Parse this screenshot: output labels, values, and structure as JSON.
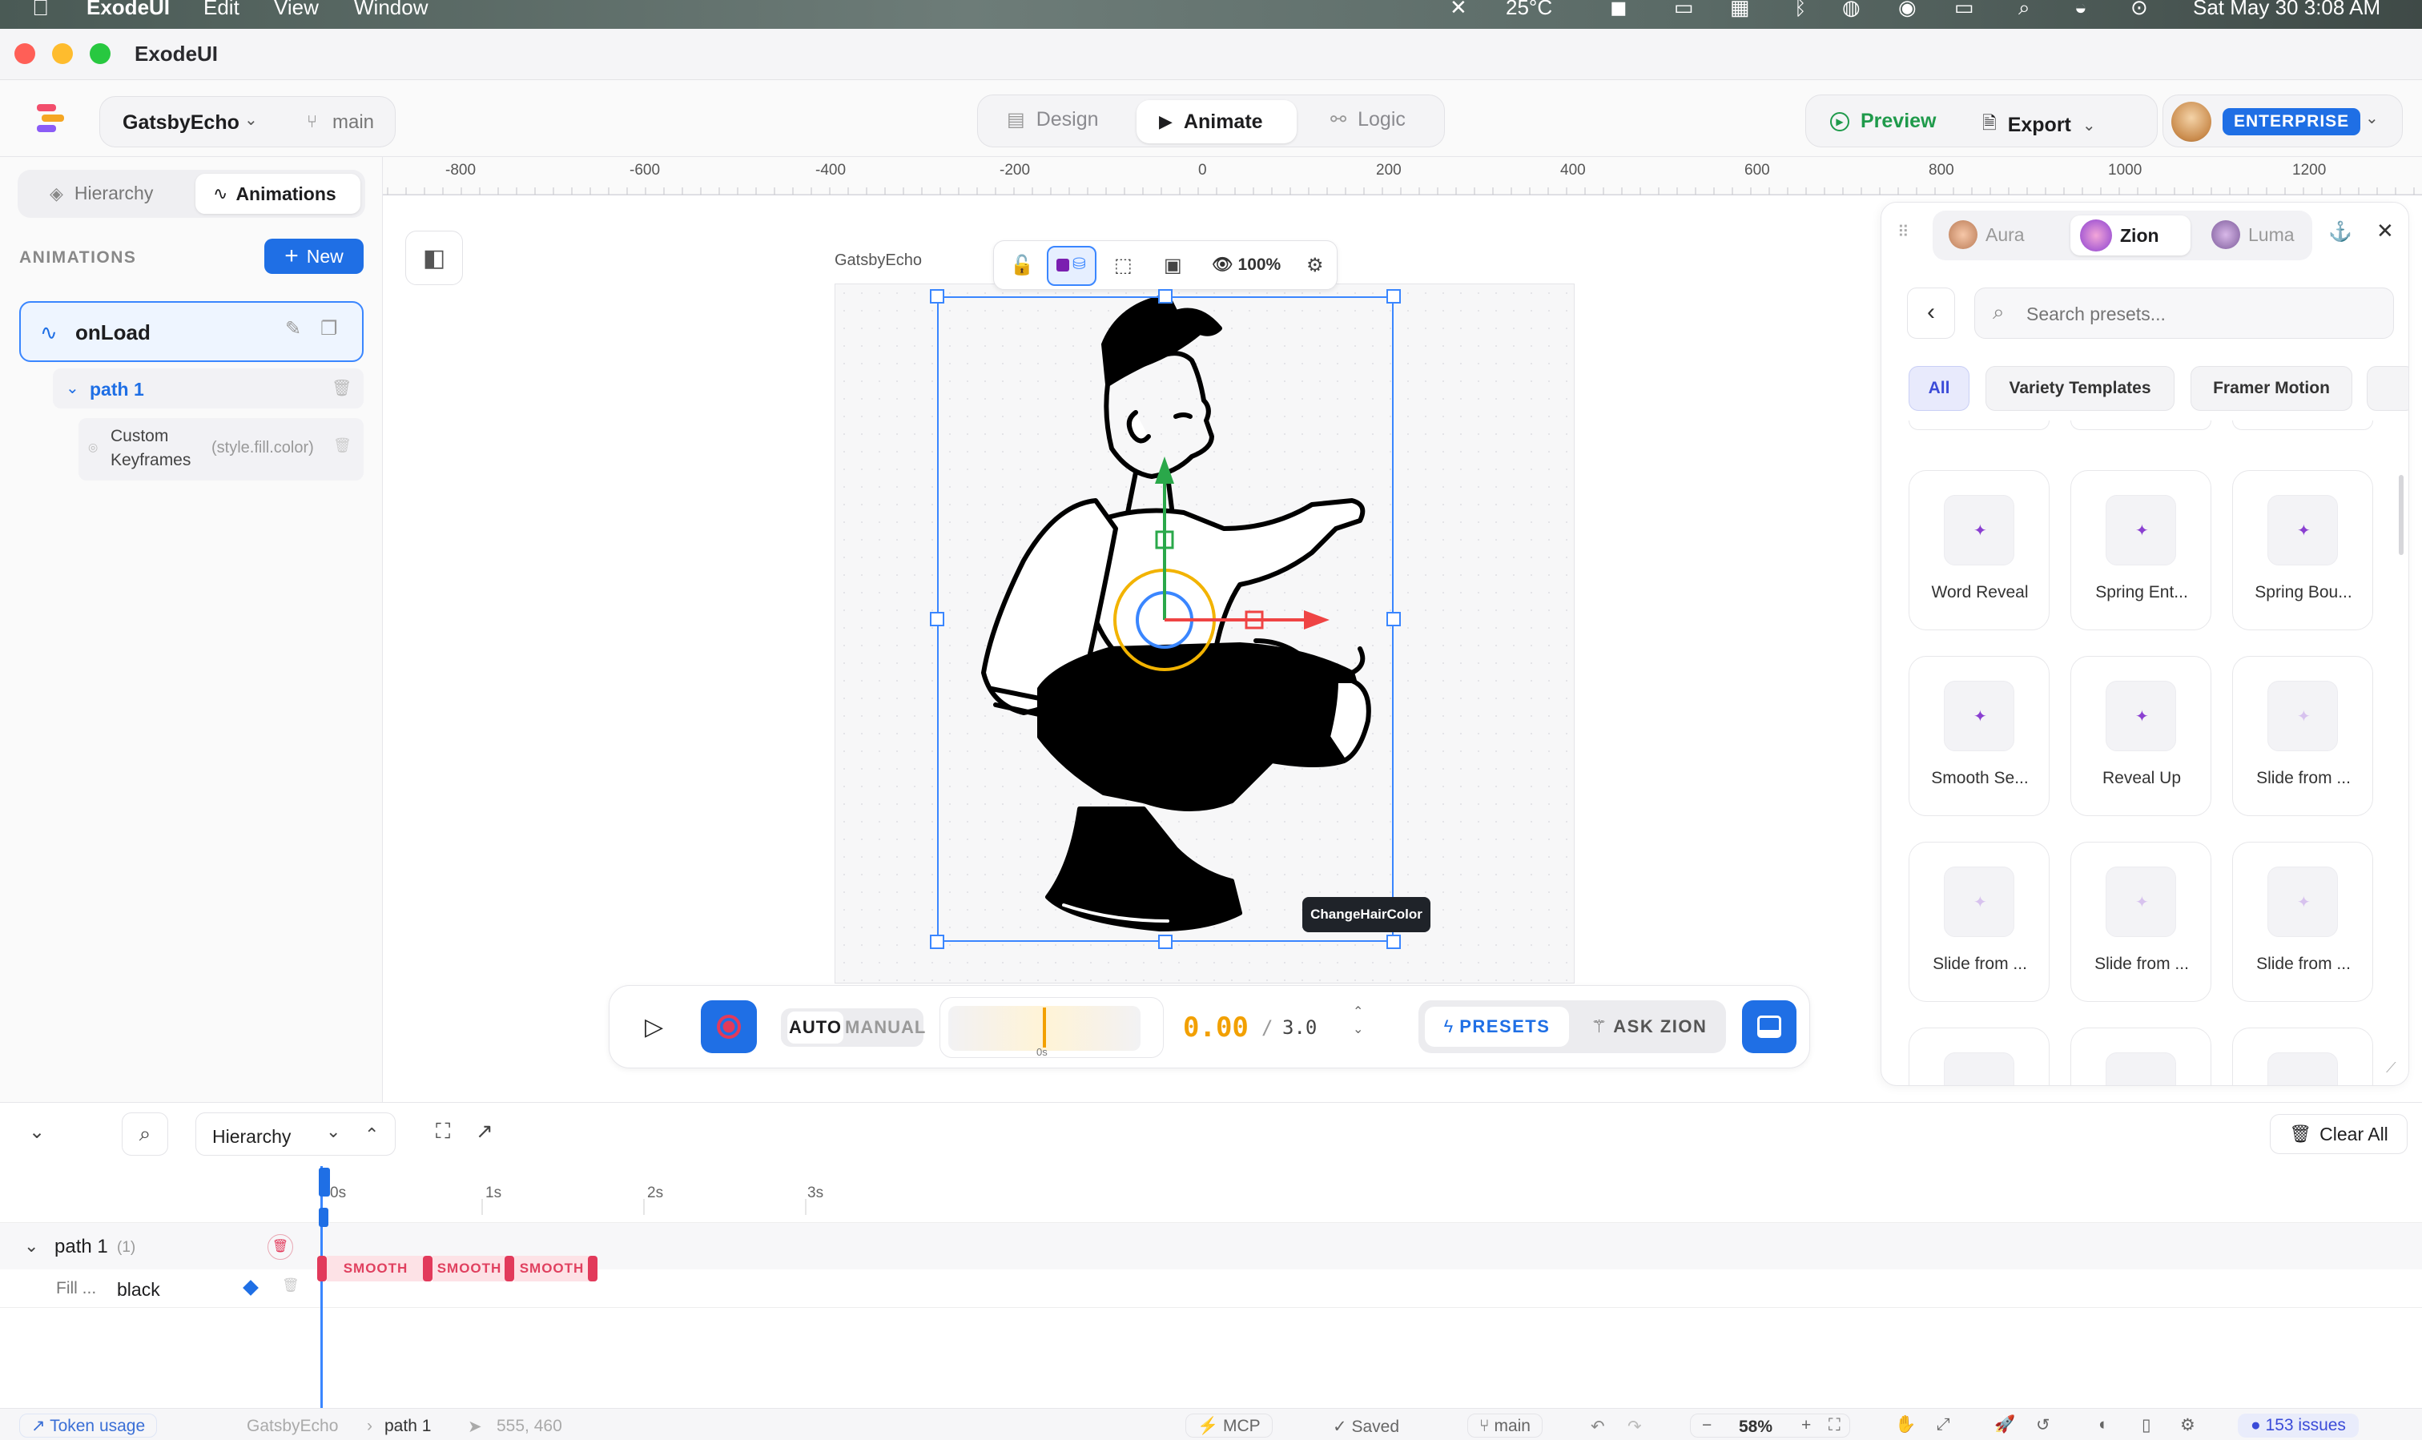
{
  "menubar": {
    "app": "ExodeUI",
    "items": [
      "Edit",
      "View",
      "Window"
    ],
    "temperature": "25°C",
    "clock": "Sat May 30  3:08 AM"
  },
  "window": {
    "title": "ExodeUI"
  },
  "toolbar": {
    "project": "GatsbyEcho",
    "branch": "main",
    "modes": [
      "Design",
      "Animate",
      "Logic"
    ],
    "active_mode": "Animate",
    "preview_label": "Preview",
    "export_label": "Export",
    "plan_badge": "ENTERPRISE"
  },
  "sidebar": {
    "tabs": [
      "Hierarchy",
      "Animations"
    ],
    "active_tab": "Animations",
    "section_title": "ANIMATIONS",
    "new_label": "New",
    "animation_name": "onLoad",
    "path_label": "path 1",
    "keyframe_label": "Custom Keyframes",
    "keyframe_prop": "(style.fill.color)"
  },
  "ruler": {
    "ticks": [
      "-800",
      "-600",
      "-400",
      "-200",
      "0",
      "200",
      "400",
      "600",
      "800",
      "1000",
      "1200"
    ]
  },
  "canvas": {
    "frame_label": "GatsbyEcho",
    "zoom_visibility": "100%",
    "tooltip": "ChangeHairColor"
  },
  "playback": {
    "auto_label": "AUTO",
    "manual_label": "MANUAL",
    "scrub_label": "0s",
    "current_time": "0.00",
    "separator": "/",
    "duration": "3.0",
    "presets_label": "PRESETS",
    "ask_label": "ASK ZION"
  },
  "presets_panel": {
    "tabs": [
      "Aura",
      "Zion",
      "Luma"
    ],
    "active_tab": "Zion",
    "search_placeholder": "Search presets...",
    "chips": [
      "All",
      "Variety Templates",
      "Framer Motion"
    ],
    "active_chip": "All",
    "cards": [
      "Word Reveal",
      "Spring Ent...",
      "Spring Bou...",
      "Smooth Se...",
      "Reveal Up",
      "Slide from ...",
      "Slide from ...",
      "Slide from ...",
      "Slide from ..."
    ]
  },
  "timeline": {
    "view_select": "Hierarchy",
    "clear_label": "Clear All",
    "time_marks": [
      "0s",
      "1s",
      "2s",
      "3s"
    ],
    "track_name": "path 1",
    "track_count": "(1)",
    "property_label": "Fill ...",
    "property_value": "black",
    "segments": [
      "SMOOTH",
      "SMOOTH",
      "SMOOTH"
    ]
  },
  "statusbar": {
    "token_usage": "Token usage",
    "crumbs": [
      "GatsbyEcho",
      "path 1"
    ],
    "coords": "555, 460",
    "mcp": "MCP",
    "saved": "Saved",
    "branch": "main",
    "zoom": "58%",
    "issues": "153 issues"
  },
  "colors": {
    "accent": "#1f6fe5",
    "record": "#e23a5b",
    "time_orange": "#f2a000",
    "enterprise": "#1f6fe5",
    "preview_green": "#1f9a4b"
  }
}
